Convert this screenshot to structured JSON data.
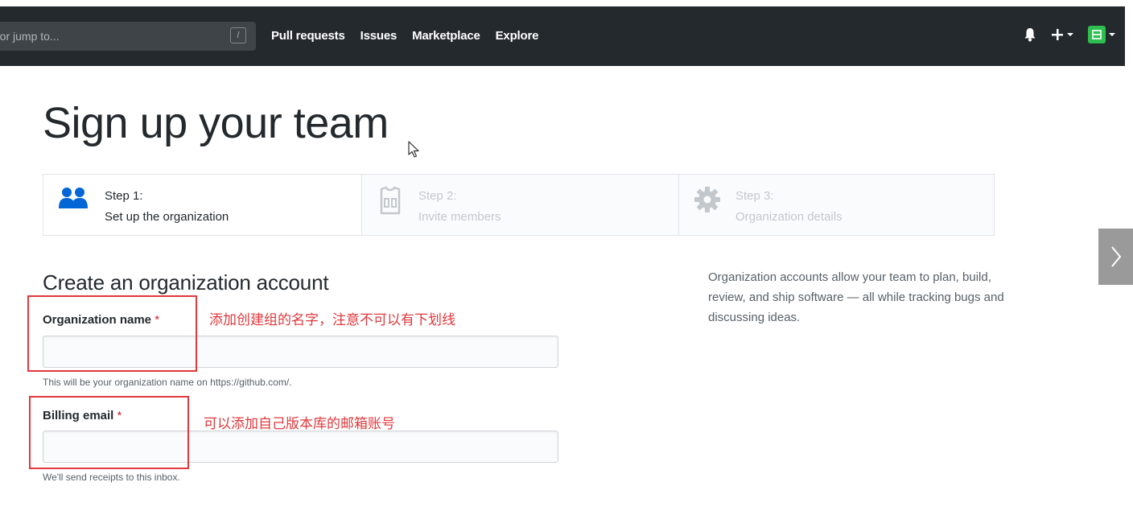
{
  "header": {
    "search_placeholder": "h or jump to...",
    "slash_hint": "/",
    "nav": [
      "Pull requests",
      "Issues",
      "Marketplace",
      "Explore"
    ]
  },
  "page": {
    "title": "Sign up your team"
  },
  "steps": [
    {
      "title": "Step 1:",
      "description": "Set up the organization",
      "state": "active",
      "icon": "people-icon"
    },
    {
      "title": "Step 2:",
      "description": "Invite members",
      "state": "inactive",
      "icon": "jersey-icon"
    },
    {
      "title": "Step 3:",
      "description": "Organization details",
      "state": "inactive",
      "icon": "gear-icon"
    }
  ],
  "form": {
    "section_title": "Create an organization account",
    "org_name": {
      "label": "Organization name",
      "required_mark": "*",
      "value": "",
      "note": "This will be your organization name on https://github.com/."
    },
    "billing_email": {
      "label": "Billing email",
      "required_mark": "*",
      "value": "",
      "note": "We'll send receipts to this inbox."
    }
  },
  "annotations": {
    "org_name": "添加创建组的名字，注意不可以有下划线",
    "billing_email": "可以添加自己版本库的邮箱账号"
  },
  "sidebar": {
    "description": "Organization accounts allow your team to plan, build, review, and ship software — all while tracking bugs and discussing ideas."
  },
  "colors": {
    "header_bg": "#24292e",
    "annotation_red": "#e0383d",
    "required_red": "#cb2431",
    "active_icon_blue": "#0366d6",
    "avatar_green": "#2cbe4e"
  }
}
